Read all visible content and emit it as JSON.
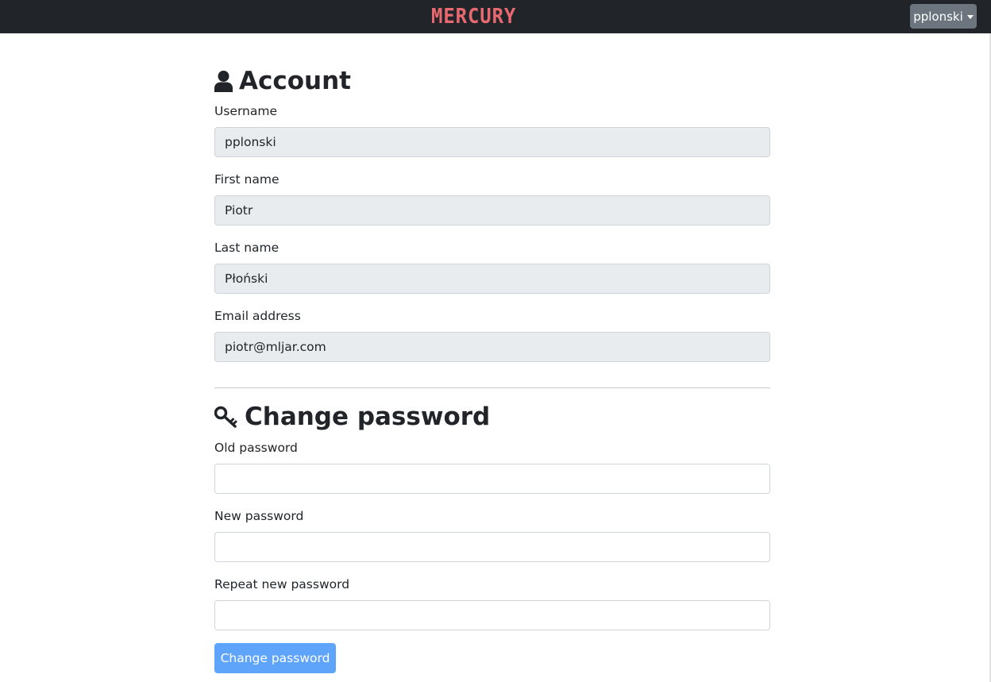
{
  "navbar": {
    "brand": "MERCURY",
    "user_menu_label": "pplonski"
  },
  "account": {
    "title": "Account",
    "icon": "user-icon",
    "fields": {
      "username": {
        "label": "Username",
        "value": "pplonski"
      },
      "first_name": {
        "label": "First name",
        "value": "Piotr"
      },
      "last_name": {
        "label": "Last name",
        "value": "Płoński"
      },
      "email": {
        "label": "Email address",
        "value": "piotr@mljar.com"
      }
    }
  },
  "change_password": {
    "title": "Change password",
    "icon": "key-icon",
    "fields": {
      "old": {
        "label": "Old password",
        "value": ""
      },
      "new": {
        "label": "New password",
        "value": ""
      },
      "repeat": {
        "label": "Repeat new password",
        "value": ""
      }
    },
    "submit_label": "Change password"
  },
  "colors": {
    "navbar_bg": "#212529",
    "brand": "#e8696f",
    "primary_button": "#5ea4fb",
    "readonly_field_bg": "#e9ecef"
  }
}
